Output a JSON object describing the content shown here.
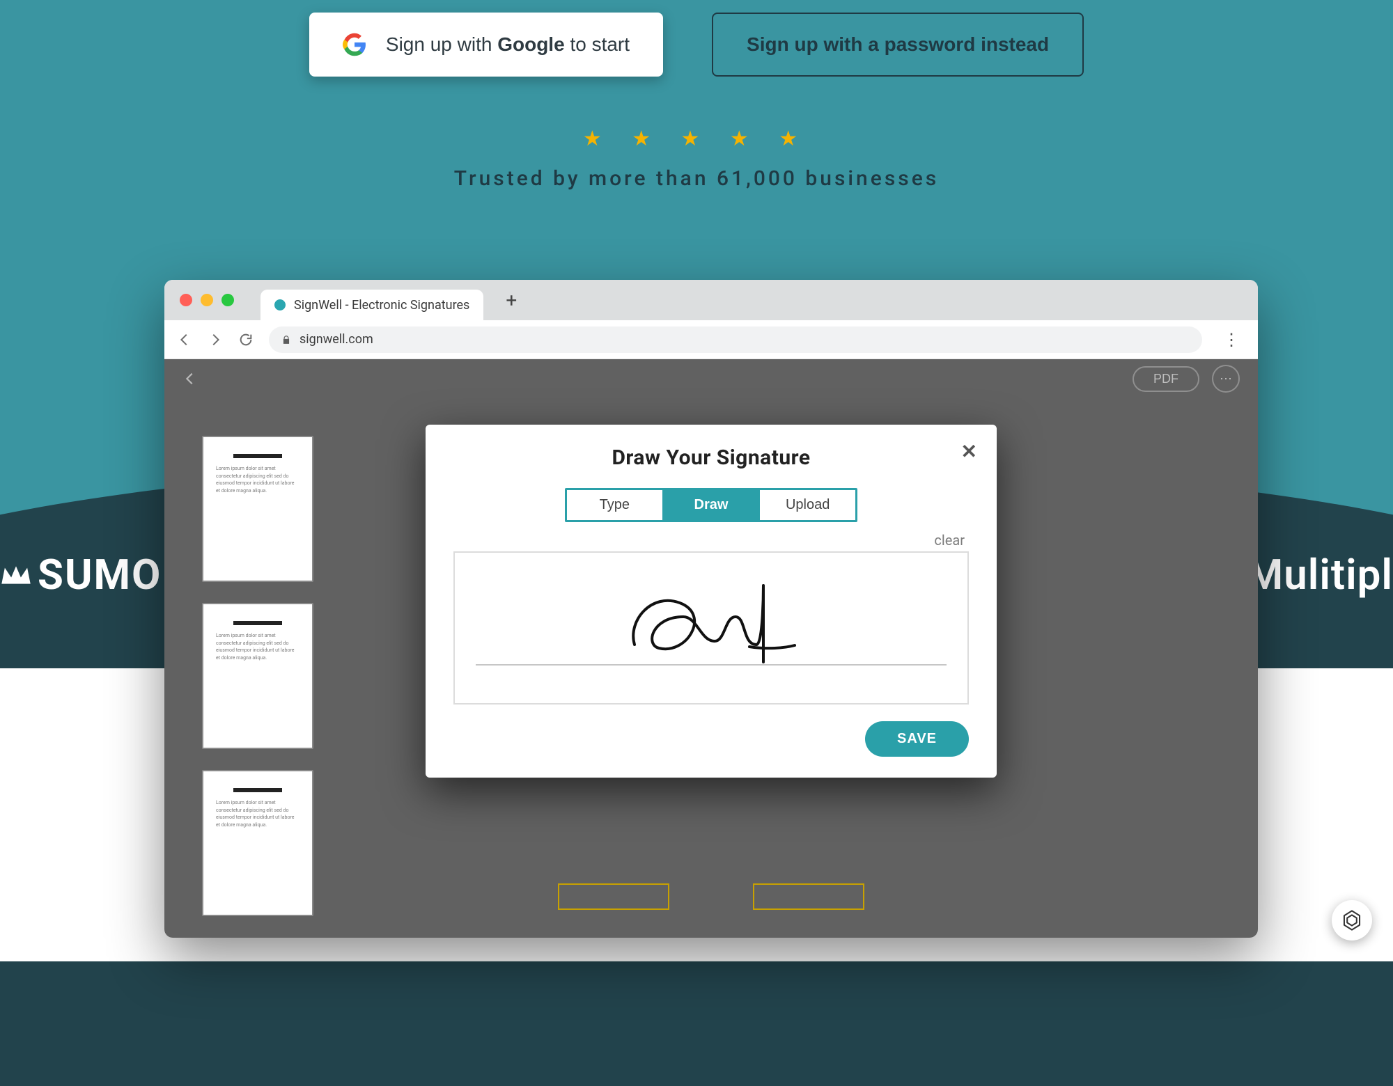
{
  "signup": {
    "google_prefix": "Sign up with ",
    "google_bold": "Google",
    "google_suffix": " to start",
    "password_label": "Sign up with a password instead"
  },
  "rating": {
    "stars": "★ ★ ★ ★ ★"
  },
  "trusted_text": "Trusted by more than 61,000 businesses",
  "logos": {
    "left": "SUMO",
    "right": "Mulitipl"
  },
  "browser": {
    "tab_title": "SignWell - Electronic Signatures",
    "address": "signwell.com"
  },
  "app": {
    "pdf_label": "PDF",
    "more_label": "⋯"
  },
  "modal": {
    "title": "Draw Your Signature",
    "tabs": {
      "type": "Type",
      "draw": "Draw",
      "upload": "Upload"
    },
    "clear": "clear",
    "save": "SAVE"
  },
  "thumbs_text": "Lorem ipsum dolor sit amet consectetur adipiscing elit sed do eiusmod tempor incididunt ut labore et dolore magna aliqua.",
  "chat_badge": "assistant"
}
